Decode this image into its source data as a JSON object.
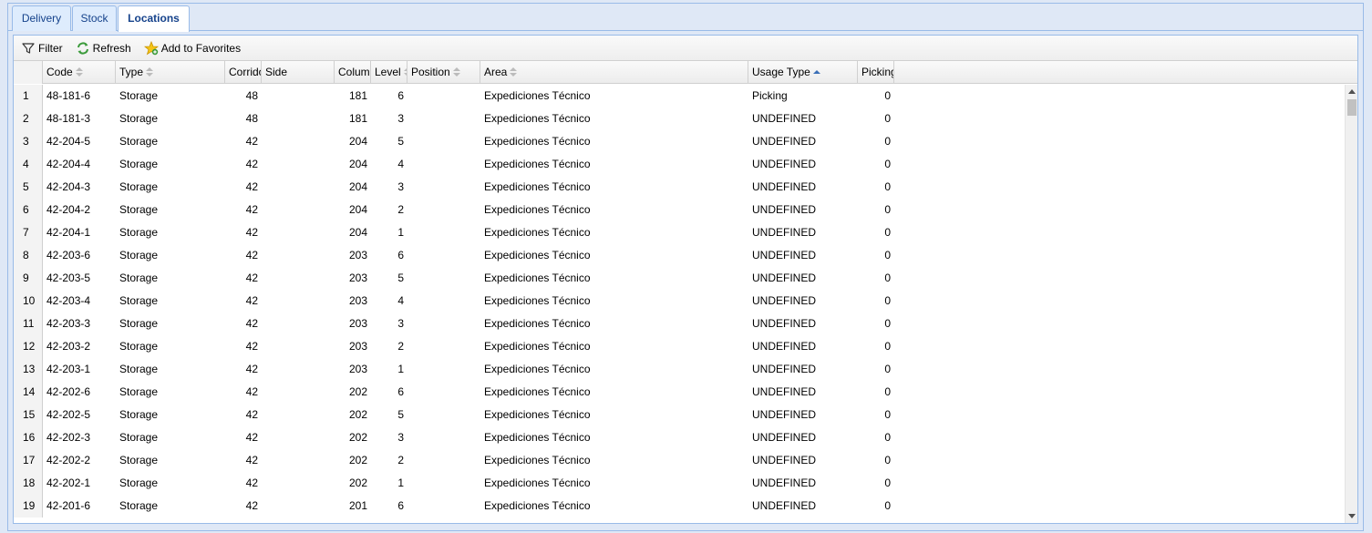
{
  "tabs": [
    {
      "label": "Delivery",
      "active": false
    },
    {
      "label": "Stock",
      "active": false
    },
    {
      "label": "Locations",
      "active": true
    }
  ],
  "toolbar": {
    "filter_label": "Filter",
    "refresh_label": "Refresh",
    "favorites_label": "Add to Favorites"
  },
  "columns": [
    {
      "label": "Code",
      "sort": "none"
    },
    {
      "label": "Type",
      "sort": "none"
    },
    {
      "label": "Corrido",
      "sort": "none"
    },
    {
      "label": "Side",
      "sort": "none"
    },
    {
      "label": "Colum",
      "sort": "none"
    },
    {
      "label": "Level",
      "sort": "none"
    },
    {
      "label": "Position",
      "sort": "none"
    },
    {
      "label": "Area",
      "sort": "none"
    },
    {
      "label": "Usage Type",
      "sort": "asc"
    },
    {
      "label": "Picking",
      "sort": "none"
    }
  ],
  "rows": [
    {
      "n": "1",
      "code": "48-181-6",
      "type": "Storage",
      "corridor": "48",
      "side": "",
      "column": "181",
      "level": "6",
      "position": "",
      "area": "Expediciones Técnico",
      "usage": "Picking",
      "picking": "0"
    },
    {
      "n": "2",
      "code": "48-181-3",
      "type": "Storage",
      "corridor": "48",
      "side": "",
      "column": "181",
      "level": "3",
      "position": "",
      "area": "Expediciones Técnico",
      "usage": "UNDEFINED",
      "picking": "0"
    },
    {
      "n": "3",
      "code": "42-204-5",
      "type": "Storage",
      "corridor": "42",
      "side": "",
      "column": "204",
      "level": "5",
      "position": "",
      "area": "Expediciones Técnico",
      "usage": "UNDEFINED",
      "picking": "0"
    },
    {
      "n": "4",
      "code": "42-204-4",
      "type": "Storage",
      "corridor": "42",
      "side": "",
      "column": "204",
      "level": "4",
      "position": "",
      "area": "Expediciones Técnico",
      "usage": "UNDEFINED",
      "picking": "0"
    },
    {
      "n": "5",
      "code": "42-204-3",
      "type": "Storage",
      "corridor": "42",
      "side": "",
      "column": "204",
      "level": "3",
      "position": "",
      "area": "Expediciones Técnico",
      "usage": "UNDEFINED",
      "picking": "0"
    },
    {
      "n": "6",
      "code": "42-204-2",
      "type": "Storage",
      "corridor": "42",
      "side": "",
      "column": "204",
      "level": "2",
      "position": "",
      "area": "Expediciones Técnico",
      "usage": "UNDEFINED",
      "picking": "0"
    },
    {
      "n": "7",
      "code": "42-204-1",
      "type": "Storage",
      "corridor": "42",
      "side": "",
      "column": "204",
      "level": "1",
      "position": "",
      "area": "Expediciones Técnico",
      "usage": "UNDEFINED",
      "picking": "0"
    },
    {
      "n": "8",
      "code": "42-203-6",
      "type": "Storage",
      "corridor": "42",
      "side": "",
      "column": "203",
      "level": "6",
      "position": "",
      "area": "Expediciones Técnico",
      "usage": "UNDEFINED",
      "picking": "0"
    },
    {
      "n": "9",
      "code": "42-203-5",
      "type": "Storage",
      "corridor": "42",
      "side": "",
      "column": "203",
      "level": "5",
      "position": "",
      "area": "Expediciones Técnico",
      "usage": "UNDEFINED",
      "picking": "0"
    },
    {
      "n": "10",
      "code": "42-203-4",
      "type": "Storage",
      "corridor": "42",
      "side": "",
      "column": "203",
      "level": "4",
      "position": "",
      "area": "Expediciones Técnico",
      "usage": "UNDEFINED",
      "picking": "0"
    },
    {
      "n": "11",
      "code": "42-203-3",
      "type": "Storage",
      "corridor": "42",
      "side": "",
      "column": "203",
      "level": "3",
      "position": "",
      "area": "Expediciones Técnico",
      "usage": "UNDEFINED",
      "picking": "0"
    },
    {
      "n": "12",
      "code": "42-203-2",
      "type": "Storage",
      "corridor": "42",
      "side": "",
      "column": "203",
      "level": "2",
      "position": "",
      "area": "Expediciones Técnico",
      "usage": "UNDEFINED",
      "picking": "0"
    },
    {
      "n": "13",
      "code": "42-203-1",
      "type": "Storage",
      "corridor": "42",
      "side": "",
      "column": "203",
      "level": "1",
      "position": "",
      "area": "Expediciones Técnico",
      "usage": "UNDEFINED",
      "picking": "0"
    },
    {
      "n": "14",
      "code": "42-202-6",
      "type": "Storage",
      "corridor": "42",
      "side": "",
      "column": "202",
      "level": "6",
      "position": "",
      "area": "Expediciones Técnico",
      "usage": "UNDEFINED",
      "picking": "0"
    },
    {
      "n": "15",
      "code": "42-202-5",
      "type": "Storage",
      "corridor": "42",
      "side": "",
      "column": "202",
      "level": "5",
      "position": "",
      "area": "Expediciones Técnico",
      "usage": "UNDEFINED",
      "picking": "0"
    },
    {
      "n": "16",
      "code": "42-202-3",
      "type": "Storage",
      "corridor": "42",
      "side": "",
      "column": "202",
      "level": "3",
      "position": "",
      "area": "Expediciones Técnico",
      "usage": "UNDEFINED",
      "picking": "0"
    },
    {
      "n": "17",
      "code": "42-202-2",
      "type": "Storage",
      "corridor": "42",
      "side": "",
      "column": "202",
      "level": "2",
      "position": "",
      "area": "Expediciones Técnico",
      "usage": "UNDEFINED",
      "picking": "0"
    },
    {
      "n": "18",
      "code": "42-202-1",
      "type": "Storage",
      "corridor": "42",
      "side": "",
      "column": "202",
      "level": "1",
      "position": "",
      "area": "Expediciones Técnico",
      "usage": "UNDEFINED",
      "picking": "0"
    },
    {
      "n": "19",
      "code": "42-201-6",
      "type": "Storage",
      "corridor": "42",
      "side": "",
      "column": "201",
      "level": "6",
      "position": "",
      "area": "Expediciones Técnico",
      "usage": "UNDEFINED",
      "picking": "0"
    }
  ],
  "icons": {
    "filter": "filter-icon",
    "refresh": "refresh-icon",
    "favorites": "star-add-icon"
  },
  "colors": {
    "border": "#99bbe8",
    "tab_text": "#15428b",
    "sort_active": "#3a6fb7"
  }
}
